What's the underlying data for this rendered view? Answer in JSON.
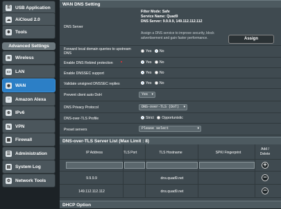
{
  "sidebar": {
    "top_items": [
      {
        "label": "USB Application",
        "icon": "usb-icon"
      },
      {
        "label": "AiCloud 2.0",
        "icon": "cloud-icon"
      },
      {
        "label": "Tools",
        "icon": "tools-icon"
      }
    ],
    "section_header": "Advanced Settings",
    "items": [
      {
        "label": "Wireless",
        "icon": "wireless-icon"
      },
      {
        "label": "LAN",
        "icon": "lan-icon"
      },
      {
        "label": "WAN",
        "icon": "globe-icon",
        "active": true
      },
      {
        "label": "Amazon Alexa",
        "icon": "alexa-icon"
      },
      {
        "label": "IPv6",
        "icon": "ipv6-icon"
      },
      {
        "label": "VPN",
        "icon": "vpn-icon"
      },
      {
        "label": "Firewall",
        "icon": "firewall-icon"
      },
      {
        "label": "Administration",
        "icon": "admin-icon"
      },
      {
        "label": "System Log",
        "icon": "log-icon"
      },
      {
        "label": "Network Tools",
        "icon": "network-tools-icon"
      }
    ]
  },
  "wan_dns": {
    "title": "WAN DNS Setting",
    "dns_server": {
      "label": "DNS Server",
      "filter_mode": "Filter Mode: Safe",
      "service_name": "Service Name: Quad9",
      "dns_server_value": "DNS Server: 9.9.9.9, 149.112.112.112",
      "hint": "Assign a DNS service to improve security, block advertisement and gain faster performance.",
      "assign_button": "Assign"
    },
    "forward_local": {
      "label": "Forward local domain queries to upstream DNS",
      "yes": "Yes",
      "no": "No",
      "selected": "No"
    },
    "rebind": {
      "label": "Enable DNS Rebind protection",
      "yes": "Yes",
      "no": "No",
      "selected": "Yes"
    },
    "dnssec": {
      "label": "Enable DNSSEC support",
      "yes": "Yes",
      "no": "No",
      "selected": "Yes"
    },
    "validate": {
      "label": "Validate unsigned DNSSEC replies",
      "yes": "Yes",
      "no": "No",
      "selected": "Yes"
    },
    "prevent_doh": {
      "label": "Prevent client auto DoH",
      "value": "Yes"
    },
    "privacy_protocol": {
      "label": "DNS Privacy Protocol",
      "value": "DNS-over-TLS (DoT)"
    },
    "dot_profile": {
      "label": "DNS-over-TLS Profile",
      "strict": "Strict",
      "opportunistic": "Opportunistic",
      "selected": "Strict"
    },
    "preset": {
      "label": "Preset servers",
      "value": "Please select"
    }
  },
  "tls_list": {
    "title": "DNS-over-TLS Server List (Max Limit : 8)",
    "headers": {
      "ip": "IP Address",
      "port": "TLS Port",
      "hostname": "TLS Hostname",
      "spki": "SPKI Fingerprint",
      "add_delete": "Add / Delete"
    },
    "rows": [
      {
        "ip": "9.9.9.9",
        "port": "",
        "hostname": "dns.quad9.net",
        "spki": ""
      },
      {
        "ip": "149.112.112.112",
        "port": "",
        "hostname": "dns.quad9.net",
        "spki": ""
      }
    ]
  },
  "dhcp": {
    "title": "DHCP Option"
  },
  "colors": {
    "accent": "#2c7fc6",
    "background": "#3f4a50",
    "sidebar": "#1c2226"
  }
}
